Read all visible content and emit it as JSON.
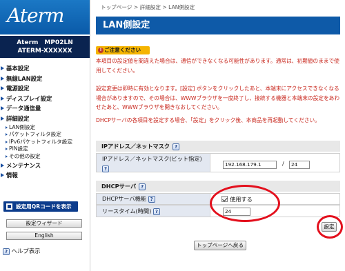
{
  "sidebar": {
    "logo": "Aterm",
    "model_line1": "Aterm　MP02LN",
    "model_line2": "ATERM-XXXXXX",
    "menu": [
      {
        "label": "基本設定",
        "type": "main"
      },
      {
        "label": "無線LAN設定",
        "type": "main"
      },
      {
        "label": "電源設定",
        "type": "main"
      },
      {
        "label": "ディスプレイ設定",
        "type": "main"
      },
      {
        "label": "データ通信量",
        "type": "main"
      },
      {
        "label": "詳細設定",
        "type": "main"
      },
      {
        "label": "LAN側設定",
        "type": "sub"
      },
      {
        "label": "パケットフィルタ設定",
        "type": "sub"
      },
      {
        "label": "IPv6パケットフィルタ設定",
        "type": "sub"
      },
      {
        "label": "PIN設定",
        "type": "sub"
      },
      {
        "label": "その他の設定",
        "type": "sub"
      },
      {
        "label": "メンテナンス",
        "type": "main"
      },
      {
        "label": "情報",
        "type": "main"
      }
    ],
    "qr_button": "設定用QRコードを表示",
    "wizard_button": "設定ウィザード",
    "english_button": "English",
    "help_label": "ヘルプ表示"
  },
  "main": {
    "breadcrumb": "トップページ > 詳細設定 > LAN側設定",
    "title": "LAN側設定",
    "caution_label": "ご注意ください",
    "notice1": "本項目の設定値を間違えた場合は、通信ができなくなる可能性があります。通常は、初期値のままで使用してください。",
    "notice2": "設定変更は即時に有効となります。[設定] ボタンをクリックしたあと、本端末にアクセスできなくなる場合がありますので、その場合は、WWWブラウザを一度終了し、接続する機器と本端末の設定をあわせたあと、WWWブラウザを開きなおしてください。",
    "notice3": "DHCPサーバの各項目を設定する場合、「設定」をクリック後、本商品を再起動してください。",
    "section_ip": "IPアドレス／ネットマスク",
    "ip_label": "IPアドレス／ネットマスク(ビット指定)",
    "ip_value": "192.168.179.1",
    "ip_separator": "/",
    "mask_value": "24",
    "section_dhcp": "DHCPサーバ",
    "dhcp_label": "DHCPサーバ機能",
    "dhcp_checkbox_label": "使用する",
    "dhcp_checked": true,
    "lease_label": "リースタイム(時間)",
    "lease_value": "24",
    "set_button": "設定",
    "back_button": "トップページへ戻る",
    "help_icon": "?"
  },
  "colors": {
    "title_bar": "#0e5aa8",
    "notice_text": "#c8261c",
    "caution_badge": "#f5b400",
    "highlight_circle": "#e3101d"
  }
}
